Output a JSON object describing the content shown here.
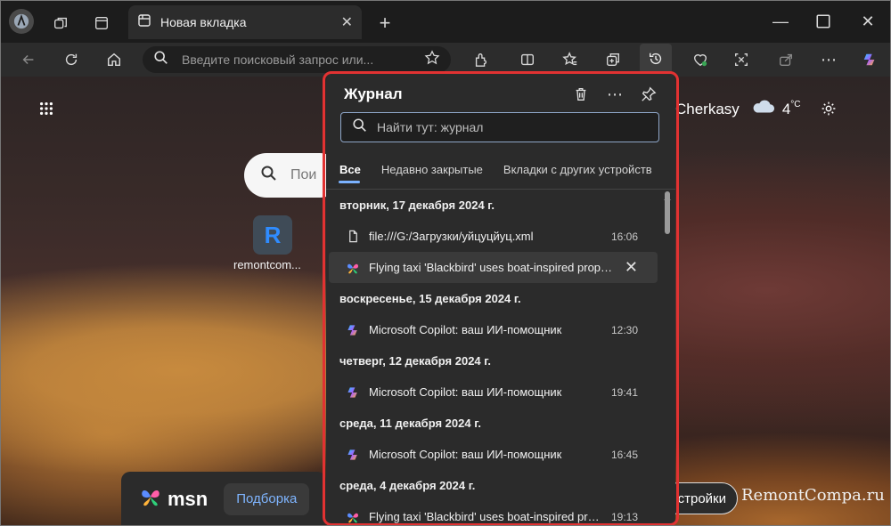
{
  "browser": {
    "tab_title": "Новая вкладка",
    "address_placeholder": "Введите поисковый запрос или..."
  },
  "newtab": {
    "city": "Cherkasy",
    "temperature": "4",
    "temp_unit": "°C",
    "search_placeholder_partial": "Пои",
    "tile_label": "remontcom...",
    "msn_logo": "msn",
    "msn_feed_button": "Подборка",
    "settings_partial": "стройки"
  },
  "watermark": "RemontCompa.ru",
  "history_panel": {
    "title": "Журнал",
    "search_placeholder": "Найти тут: журнал",
    "tabs": [
      {
        "label": "Все",
        "active": true
      },
      {
        "label": "Недавно закрытые",
        "active": false
      },
      {
        "label": "Вкладки с других устройств",
        "active": false
      }
    ],
    "groups": [
      {
        "date": "вторник, 17 декабря 2024 г.",
        "entries": [
          {
            "title": "file:///G:/Загрузки/уйцуцйуц.xml",
            "time": "16:06",
            "icon": "file-icon",
            "hover": false
          },
          {
            "title": "Flying taxi 'Blackbird' uses boat-inspired propul...",
            "time": "",
            "icon": "msn-butterfly-icon",
            "hover": true
          }
        ]
      },
      {
        "date": "воскресенье, 15 декабря 2024 г.",
        "entries": [
          {
            "title": "Microsoft Copilot: ваш ИИ-помощник",
            "time": "12:30",
            "icon": "copilot-icon",
            "hover": false
          }
        ]
      },
      {
        "date": "четверг, 12 декабря 2024 г.",
        "entries": [
          {
            "title": "Microsoft Copilot: ваш ИИ-помощник",
            "time": "19:41",
            "icon": "copilot-icon",
            "hover": false
          }
        ]
      },
      {
        "date": "среда, 11 декабря 2024 г.",
        "entries": [
          {
            "title": "Microsoft Copilot: ваш ИИ-помощник",
            "time": "16:45",
            "icon": "copilot-icon",
            "hover": false
          }
        ]
      },
      {
        "date": "среда, 4 декабря 2024 г.",
        "entries": [
          {
            "title": "Flying taxi 'Blackbird' uses boat-inspired propul...",
            "time": "19:13",
            "icon": "msn-butterfly-icon",
            "hover": false
          }
        ]
      }
    ]
  },
  "colors": {
    "accent": "#7bb2ff",
    "highlight_outline": "#e23232",
    "panel_bg": "#2b2b2b"
  }
}
